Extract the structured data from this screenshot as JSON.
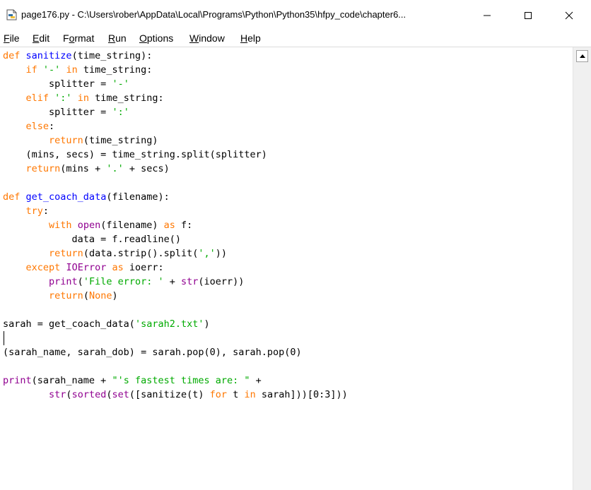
{
  "window": {
    "title": "page176.py - C:\\Users\\rober\\AppData\\Local\\Programs\\Python\\Python35\\hfpy_code\\chapter6...",
    "minimize_glyph": "—",
    "maximize_glyph": "☐",
    "close_glyph": "✕"
  },
  "menu": [
    {
      "label": "File",
      "u": "F",
      "rest": "ile"
    },
    {
      "label": "Edit",
      "u": "E",
      "rest": "dit"
    },
    {
      "label": "Format",
      "pre": "F",
      "u": "o",
      "rest": "rmat"
    },
    {
      "label": "Run",
      "u": "R",
      "rest": "un"
    },
    {
      "label": "Options",
      "u": "O",
      "rest": "ptions"
    },
    {
      "label": "Window",
      "u": "W",
      "rest": "indow"
    },
    {
      "label": "Help",
      "u": "H",
      "rest": "elp"
    }
  ],
  "editor": {
    "lines": [
      [
        [
          "def",
          "kw"
        ],
        [
          " ",
          ""
        ],
        [
          "sanitize",
          "def"
        ],
        [
          "(time_string):",
          ""
        ]
      ],
      [
        [
          "    ",
          ""
        ],
        [
          "if",
          "kw"
        ],
        [
          " ",
          ""
        ],
        [
          "'-'",
          "str"
        ],
        [
          " ",
          ""
        ],
        [
          "in",
          "kw"
        ],
        [
          " time_string:",
          ""
        ]
      ],
      [
        [
          "        splitter = ",
          ""
        ],
        [
          "'-'",
          "str"
        ]
      ],
      [
        [
          "    ",
          ""
        ],
        [
          "elif",
          "kw"
        ],
        [
          " ",
          ""
        ],
        [
          "':'",
          "str"
        ],
        [
          " ",
          ""
        ],
        [
          "in",
          "kw"
        ],
        [
          " time_string:",
          ""
        ]
      ],
      [
        [
          "        splitter = ",
          ""
        ],
        [
          "':'",
          "str"
        ]
      ],
      [
        [
          "    ",
          ""
        ],
        [
          "else",
          "kw"
        ],
        [
          ":",
          ""
        ]
      ],
      [
        [
          "        ",
          ""
        ],
        [
          "return",
          "kw"
        ],
        [
          "(time_string)",
          ""
        ]
      ],
      [
        [
          "    (mins, secs) = time_string.split(splitter)",
          ""
        ]
      ],
      [
        [
          "    ",
          ""
        ],
        [
          "return",
          "kw"
        ],
        [
          "(mins + ",
          ""
        ],
        [
          "'.'",
          "str"
        ],
        [
          " + secs)",
          ""
        ]
      ],
      [
        [
          "",
          ""
        ]
      ],
      [
        [
          "def",
          "kw"
        ],
        [
          " ",
          ""
        ],
        [
          "get_coach_data",
          "def"
        ],
        [
          "(filename):",
          ""
        ]
      ],
      [
        [
          "    ",
          ""
        ],
        [
          "try",
          "kw"
        ],
        [
          ":",
          ""
        ]
      ],
      [
        [
          "        ",
          ""
        ],
        [
          "with",
          "kw"
        ],
        [
          " ",
          ""
        ],
        [
          "open",
          "bi"
        ],
        [
          "(filename) ",
          ""
        ],
        [
          "as",
          "kw"
        ],
        [
          " f:",
          ""
        ]
      ],
      [
        [
          "            data = f.readline()",
          ""
        ]
      ],
      [
        [
          "        ",
          ""
        ],
        [
          "return",
          "kw"
        ],
        [
          "(data.strip().split(",
          ""
        ],
        [
          "','",
          "str"
        ],
        [
          "))",
          ""
        ]
      ],
      [
        [
          "    ",
          ""
        ],
        [
          "except",
          "kw"
        ],
        [
          " ",
          ""
        ],
        [
          "IOError",
          "bi"
        ],
        [
          " ",
          ""
        ],
        [
          "as",
          "kw"
        ],
        [
          " ioerr:",
          ""
        ]
      ],
      [
        [
          "        ",
          ""
        ],
        [
          "print",
          "bi"
        ],
        [
          "(",
          ""
        ],
        [
          "'File error: '",
          "str"
        ],
        [
          " + ",
          ""
        ],
        [
          "str",
          "bi"
        ],
        [
          "(ioerr))",
          ""
        ]
      ],
      [
        [
          "        ",
          ""
        ],
        [
          "return",
          "kw"
        ],
        [
          "(",
          ""
        ],
        [
          "None",
          "kw"
        ],
        [
          ")",
          ""
        ]
      ],
      [
        [
          "",
          ""
        ]
      ],
      [
        [
          "sarah = get_coach_data(",
          ""
        ],
        [
          "'sarah2.txt'",
          "str"
        ],
        [
          ")",
          ""
        ]
      ],
      [
        [
          "",
          ""
        ]
      ],
      [
        [
          "(sarah_name, sarah_dob) = sarah.pop(0), sarah.pop(0)",
          ""
        ]
      ],
      [
        [
          "",
          ""
        ]
      ],
      [
        [
          "print",
          "bi"
        ],
        [
          "(sarah_name + ",
          ""
        ],
        [
          "\"'s fastest times are: \"",
          "str"
        ],
        [
          " +",
          ""
        ]
      ],
      [
        [
          "        ",
          ""
        ],
        [
          "str",
          "bi"
        ],
        [
          "(",
          ""
        ],
        [
          "sorted",
          "bi"
        ],
        [
          "(",
          ""
        ],
        [
          "set",
          "bi"
        ],
        [
          "([sanitize(t) ",
          ""
        ],
        [
          "for",
          "kw"
        ],
        [
          " t ",
          ""
        ],
        [
          "in",
          "kw"
        ],
        [
          " sarah]))[0:3]))",
          ""
        ]
      ]
    ]
  },
  "colors": {
    "keyword": "#ff7700",
    "builtin": "#900090",
    "string": "#00aa00",
    "definition": "#0000ff"
  },
  "icons": {
    "app": "python-idle-icon",
    "scroll_up": "scroll-up-arrow-icon"
  }
}
